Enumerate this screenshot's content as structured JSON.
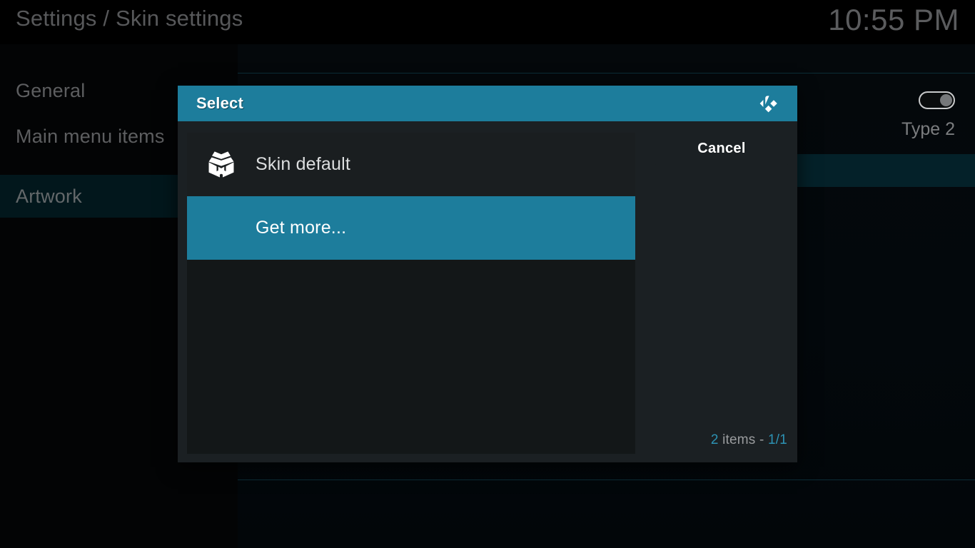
{
  "window": {
    "title": "Settings / Skin settings",
    "clock": "10:55 PM"
  },
  "colors": {
    "accent_teal": "#1d7d9c",
    "accent_text": "#2d93b4",
    "dialog_bg": "#1b2023",
    "list_bg": "#131718",
    "row_bg": "#1a1e20",
    "selected_category_bg": "#02171c",
    "background": "#040607"
  },
  "sidebar": {
    "items": [
      {
        "label": "General",
        "selected": false
      },
      {
        "label": "Main menu items",
        "selected": false
      },
      {
        "label": "Artwork",
        "selected": true
      }
    ]
  },
  "background_panel": {
    "toggle": {
      "name": "setting-toggle",
      "state": "on"
    },
    "setting_value": "Type 2"
  },
  "dialog": {
    "title": "Select",
    "logo_icon": "kodi-logo-icon",
    "items": [
      {
        "label": "Skin default",
        "icon": "open-box-icon",
        "focused": false
      },
      {
        "label": "Get more...",
        "icon": "",
        "focused": true
      }
    ],
    "cancel_label": "Cancel",
    "footer": {
      "count": "2",
      "count_suffix": " items - ",
      "page": "1/1"
    }
  }
}
